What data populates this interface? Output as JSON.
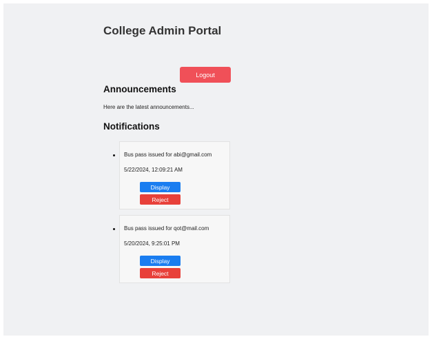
{
  "header": {
    "title": "College Admin Portal",
    "logout_label": "Logout"
  },
  "announcements": {
    "heading": "Announcements",
    "text": "Here are the latest announcements..."
  },
  "notifications": {
    "heading": "Notifications",
    "items": [
      {
        "message": "Bus pass issued for abi@gmail.com",
        "timestamp": "5/22/2024, 12:09:21 AM",
        "display_label": "Display",
        "reject_label": "Reject"
      },
      {
        "message": "Bus pass issued for qot@mail.com",
        "timestamp": "5/20/2024, 9:25:01 PM",
        "display_label": "Display",
        "reject_label": "Reject"
      }
    ]
  },
  "colors": {
    "logout": "#f05058",
    "display": "#1a7df0",
    "reject": "#e8413a",
    "background": "#f0f1f3"
  }
}
